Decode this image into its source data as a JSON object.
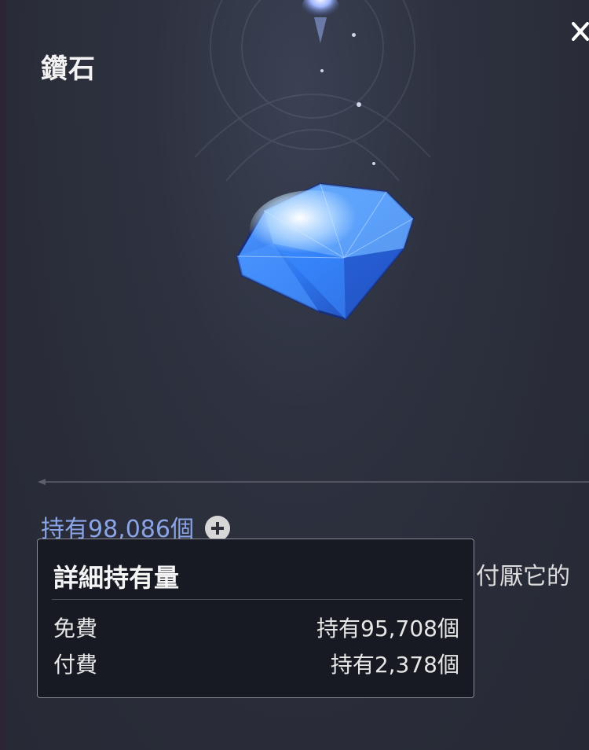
{
  "header": {
    "title": "鑽石"
  },
  "item": {
    "icon": "diamond-gem-icon",
    "held_text": "持有98,086個",
    "description_partial": "付厭它的"
  },
  "tooltip": {
    "title": "詳細持有量",
    "rows": [
      {
        "label": "免費",
        "value": "持有95,708個"
      },
      {
        "label": "付費",
        "value": "持有2,378個"
      }
    ]
  },
  "colors": {
    "background": "#2b2e3a",
    "held_text": "#8aa4e6",
    "tooltip_bg": "#171a22",
    "gem_blue": "#3f86ff"
  }
}
